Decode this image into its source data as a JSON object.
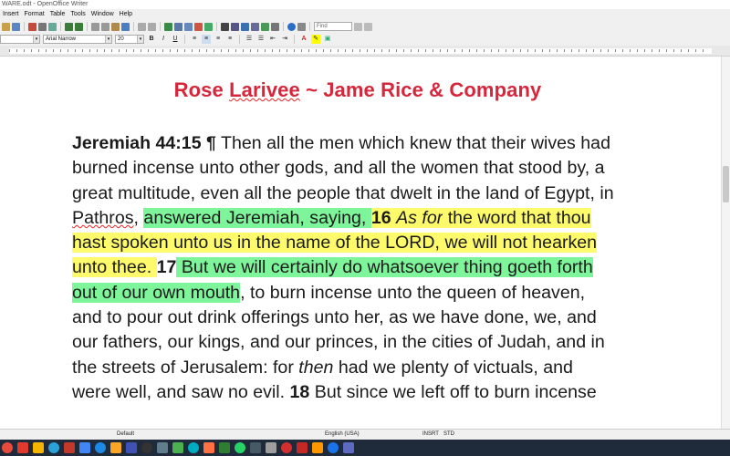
{
  "window": {
    "title": "WARE.odt - OpenOffice Writer"
  },
  "menu": [
    "Insert",
    "Format",
    "Table",
    "Tools",
    "Window",
    "Help"
  ],
  "toolbar": {
    "find_placeholder": "Find"
  },
  "format": {
    "style": "Default",
    "font": "Arial Narrow",
    "size": "20",
    "bold": "B",
    "italic": "I",
    "underline": "U"
  },
  "document": {
    "heading_plain": "Rose ",
    "heading_misspelled": "Larivee",
    "heading_rest": " ~ Jame Rice & Company",
    "lines": [
      {
        "segments": [
          {
            "t": "Jeremiah 44:15 ¶",
            "s": "b"
          },
          {
            "t": " Then all the men which knew that their wives had",
            "s": ""
          }
        ]
      },
      {
        "segments": [
          {
            "t": "burned incense unto other gods, and all the women that stood by, a",
            "s": ""
          }
        ]
      },
      {
        "segments": [
          {
            "t": "great multitude, even all the people that dwelt in the land of Egypt, in",
            "s": ""
          }
        ]
      },
      {
        "segments": [
          {
            "t": "Pathros",
            "s": "spell"
          },
          {
            "t": ", ",
            "s": ""
          },
          {
            "t": "answered Jeremiah, saying, ",
            "s": "green"
          },
          {
            "t": "16 ",
            "s": "yellow b"
          },
          {
            "t": "As for",
            "s": "yellow i"
          },
          {
            "t": " the word that thou",
            "s": "yellow"
          }
        ]
      },
      {
        "segments": [
          {
            "t": "hast spoken unto us in the name of the LORD, we will not hearken",
            "s": "yellow"
          }
        ]
      },
      {
        "segments": [
          {
            "t": "unto thee. ",
            "s": "yellow"
          },
          {
            "t": "17",
            "s": "b"
          },
          {
            "t": " But we will certainly do whatsoever thing goeth forth",
            "s": "green"
          }
        ]
      },
      {
        "segments": [
          {
            "t": "out of our own mouth",
            "s": "green"
          },
          {
            "t": ", to burn incense unto the queen of heaven,",
            "s": ""
          }
        ]
      },
      {
        "segments": [
          {
            "t": "and to pour out drink offerings unto her, as we have done, we, and",
            "s": ""
          }
        ]
      },
      {
        "segments": [
          {
            "t": "our fathers, our kings, and our princes, in the cities of Judah, and in",
            "s": ""
          }
        ]
      },
      {
        "segments": [
          {
            "t": "the streets of Jerusalem: for ",
            "s": ""
          },
          {
            "t": "then",
            "s": "i"
          },
          {
            "t": " had we plenty of victuals, and",
            "s": ""
          }
        ]
      },
      {
        "segments": [
          {
            "t": "were well, and saw no evil. ",
            "s": ""
          },
          {
            "t": "18",
            "s": "b"
          },
          {
            "t": " But since we left off to burn incense",
            "s": ""
          }
        ]
      }
    ]
  },
  "status": {
    "page_style": "Default",
    "language": "English (USA)",
    "insert_mode": "INSRT",
    "selection_mode": "STD"
  },
  "colors": {
    "heading": "#d6263b",
    "highlight_green": "#7ef59a",
    "highlight_yellow": "#fdfb6b",
    "taskbar": "#1f2a3a"
  },
  "taskbar_icons": [
    "chrome-icon",
    "gmail-icon",
    "files-icon",
    "telegram-icon",
    "record-icon",
    "browser-icon",
    "mail-icon",
    "notes-icon",
    "window-icon",
    "terminal-icon",
    "image-icon",
    "editor-icon",
    "chat-icon",
    "firefox-icon",
    "vpn-icon",
    "whatsapp-icon",
    "camera-icon",
    "alien-icon",
    "pdf-icon",
    "acrobat-icon",
    "vlc-icon",
    "drive-icon",
    "globe-icon"
  ]
}
